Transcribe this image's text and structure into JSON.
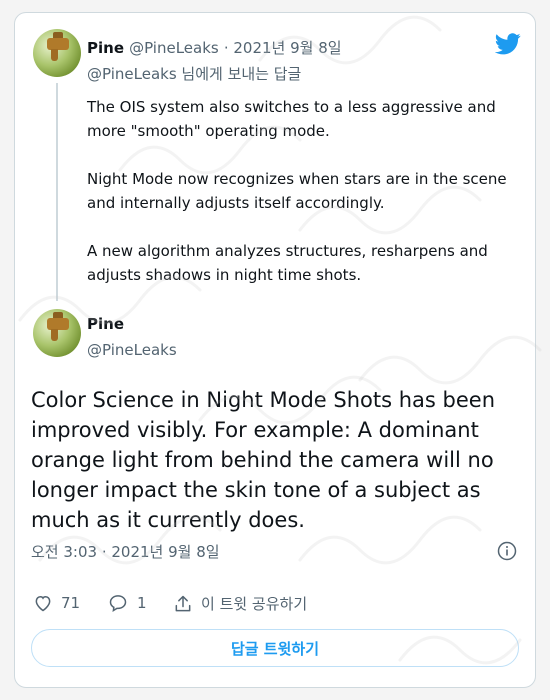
{
  "colors": {
    "accent": "#1d9bf0",
    "muted": "#536471",
    "border": "#cfd9de"
  },
  "quoted": {
    "author_name": "Pine",
    "author_handle": "@PineLeaks",
    "date": "· 2021년 9월 8일",
    "reply_to": "@PineLeaks 님에게 보내는 답글",
    "paragraphs": [
      "The OIS system also switches to a less aggressive and more \"smooth\" operating mode.",
      "Night Mode now recognizes when stars are in the scene and internally adjusts itself accordingly.",
      "A new algorithm analyzes structures, resharpens and adjusts shadows in night time shots."
    ]
  },
  "tweet": {
    "author_name": "Pine",
    "author_handle": "@PineLeaks",
    "text": "Color Science in Night Mode Shots has been improved visibly. For example: A dominant orange light from behind the camera will no longer impact the skin tone of a subject as much as it currently does.",
    "timestamp": "오전 3:03 · 2021년 9월 8일"
  },
  "actions": {
    "likes": "71",
    "replies": "1",
    "share_label": "이 트윗 공유하기"
  },
  "reply_button_label": "답글 트윗하기",
  "icons": [
    "twitter-bird-icon",
    "info-icon",
    "heart-icon",
    "reply-bubble-icon",
    "share-icon"
  ]
}
